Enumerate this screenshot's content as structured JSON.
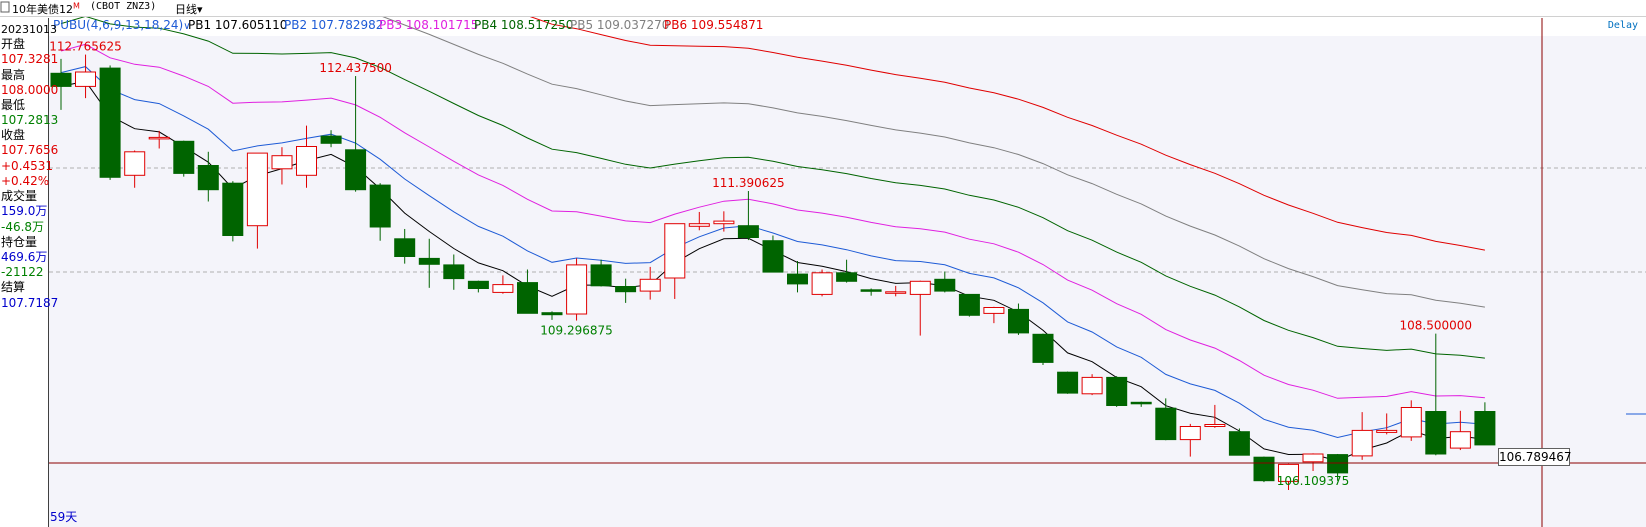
{
  "toolbar": {
    "title": "10年美债12",
    "title_sup": "M",
    "code": "(CBOT ZNZ3)",
    "period": "日线",
    "period_chevron": "▾"
  },
  "legend": {
    "indicator": "PUBU(4,6,9,13,18,24)",
    "items": [
      {
        "label": "PB1 107.605110",
        "color": "#000000"
      },
      {
        "label": "PB2 107.782982",
        "color": "#1e5bd6"
      },
      {
        "label": "PB3 108.101715",
        "color": "#e020e0"
      },
      {
        "label": "PB4 108.517250",
        "color": "#006400"
      },
      {
        "label": "PB5 109.037270",
        "color": "#808080"
      },
      {
        "label": "PB6 109.554871",
        "color": "#e00000"
      }
    ]
  },
  "info_panel": {
    "date": "20231013",
    "open_label": "开盘",
    "open_value": "107.3281",
    "high_label": "最高",
    "high_value": "108.0000",
    "low_label": "最低",
    "low_value": "107.2813",
    "close_label": "收盘",
    "close_value": "107.7656",
    "change": "+0.4531",
    "change_pct": "+0.42%",
    "volume_label": "成交量",
    "volume_value": "159.0万",
    "volume_change": "-46.8万",
    "oi_label": "持仓量",
    "oi_value": "469.6万",
    "oi_change": "-21122",
    "settle_label": "结算",
    "settle_value": "107.7187"
  },
  "status": {
    "delay": "Delay",
    "current_price": "106.789467",
    "day_count": "59天"
  },
  "colors": {
    "up": "#e00000",
    "down": "#006400",
    "background": "#f4f4fa",
    "crosshair": "#8b0000",
    "up_text": "#e00000",
    "down_text": "#008000",
    "neutral_text": "#0000cc"
  },
  "chart_data": {
    "type": "candlestick",
    "series_name": "10年美债12",
    "annotations": [
      {
        "label": "112.765625",
        "kind": "high",
        "index": 1
      },
      {
        "label": "112.437500",
        "kind": "high",
        "index": 12
      },
      {
        "label": "109.296875",
        "kind": "low",
        "index": 21
      },
      {
        "label": "111.390625",
        "kind": "high",
        "index": 28
      },
      {
        "label": "106.109375",
        "kind": "low",
        "index": 51
      },
      {
        "label": "108.500000",
        "kind": "high",
        "index": 56
      }
    ],
    "candles": [
      {
        "o": 112.48,
        "h": 112.7,
        "l": 111.92,
        "c": 112.28
      },
      {
        "o": 112.28,
        "h": 112.766,
        "l": 112.1,
        "c": 112.5
      },
      {
        "o": 112.56,
        "h": 112.6,
        "l": 110.85,
        "c": 110.89
      },
      {
        "o": 110.92,
        "h": 111.3,
        "l": 110.73,
        "c": 111.28
      },
      {
        "o": 111.5,
        "h": 111.6,
        "l": 111.33,
        "c": 111.5
      },
      {
        "o": 111.44,
        "h": 111.45,
        "l": 110.9,
        "c": 110.95
      },
      {
        "o": 111.07,
        "h": 111.28,
        "l": 110.52,
        "c": 110.7
      },
      {
        "o": 110.8,
        "h": 110.83,
        "l": 109.91,
        "c": 110.0
      },
      {
        "o": 110.15,
        "h": 111.26,
        "l": 109.8,
        "c": 111.26
      },
      {
        "o": 111.02,
        "h": 111.35,
        "l": 110.78,
        "c": 111.22
      },
      {
        "o": 110.92,
        "h": 111.68,
        "l": 110.73,
        "c": 111.36
      },
      {
        "o": 111.52,
        "h": 111.61,
        "l": 111.35,
        "c": 111.41
      },
      {
        "o": 111.31,
        "h": 112.4375,
        "l": 110.67,
        "c": 110.7
      },
      {
        "o": 110.77,
        "h": 110.8,
        "l": 109.92,
        "c": 110.13
      },
      {
        "o": 109.95,
        "h": 110.1,
        "l": 109.57,
        "c": 109.68
      },
      {
        "o": 109.65,
        "h": 109.95,
        "l": 109.2,
        "c": 109.56
      },
      {
        "o": 109.55,
        "h": 109.71,
        "l": 109.17,
        "c": 109.34
      },
      {
        "o": 109.3,
        "h": 109.31,
        "l": 109.13,
        "c": 109.19
      },
      {
        "o": 109.13,
        "h": 109.39,
        "l": 109.11,
        "c": 109.25
      },
      {
        "o": 109.28,
        "h": 109.48,
        "l": 108.81,
        "c": 108.81
      },
      {
        "o": 108.82,
        "h": 108.84,
        "l": 108.71,
        "c": 108.79
      },
      {
        "o": 108.8,
        "h": 109.65,
        "l": 108.7,
        "c": 109.55
      },
      {
        "o": 109.55,
        "h": 109.63,
        "l": 109.22,
        "c": 109.23
      },
      {
        "o": 109.22,
        "h": 109.34,
        "l": 108.97,
        "c": 109.14
      },
      {
        "o": 109.15,
        "h": 109.52,
        "l": 109.02,
        "c": 109.33
      },
      {
        "o": 109.35,
        "h": 110.18,
        "l": 109.03,
        "c": 110.18
      },
      {
        "o": 110.14,
        "h": 110.36,
        "l": 110.08,
        "c": 110.18
      },
      {
        "o": 110.18,
        "h": 110.37,
        "l": 110.06,
        "c": 110.22
      },
      {
        "o": 110.15,
        "h": 110.68,
        "l": 109.93,
        "c": 109.97
      },
      {
        "o": 109.92,
        "h": 110.0,
        "l": 109.44,
        "c": 109.44
      },
      {
        "o": 109.41,
        "h": 109.61,
        "l": 109.13,
        "c": 109.26
      },
      {
        "o": 109.1,
        "h": 109.48,
        "l": 109.07,
        "c": 109.43
      },
      {
        "o": 109.43,
        "h": 109.63,
        "l": 109.28,
        "c": 109.3
      },
      {
        "o": 109.17,
        "h": 109.19,
        "l": 109.08,
        "c": 109.15
      },
      {
        "o": 109.12,
        "h": 109.23,
        "l": 109.07,
        "c": 109.14
      },
      {
        "o": 109.1,
        "h": 109.31,
        "l": 108.47,
        "c": 109.3
      },
      {
        "o": 109.33,
        "h": 109.45,
        "l": 109.13,
        "c": 109.15
      },
      {
        "o": 109.1,
        "h": 109.1,
        "l": 108.76,
        "c": 108.78
      },
      {
        "o": 108.81,
        "h": 108.91,
        "l": 108.66,
        "c": 108.9
      },
      {
        "o": 108.87,
        "h": 108.96,
        "l": 108.48,
        "c": 108.51
      },
      {
        "o": 108.49,
        "h": 108.5,
        "l": 108.02,
        "c": 108.06
      },
      {
        "o": 107.91,
        "h": 107.92,
        "l": 107.58,
        "c": 107.59
      },
      {
        "o": 107.58,
        "h": 107.88,
        "l": 107.56,
        "c": 107.83
      },
      {
        "o": 107.83,
        "h": 107.85,
        "l": 107.38,
        "c": 107.4
      },
      {
        "o": 107.45,
        "h": 107.46,
        "l": 107.38,
        "c": 107.44
      },
      {
        "o": 107.36,
        "h": 107.51,
        "l": 106.87,
        "c": 106.88
      },
      {
        "o": 106.88,
        "h": 107.12,
        "l": 106.62,
        "c": 107.08
      },
      {
        "o": 107.08,
        "h": 107.41,
        "l": 107.06,
        "c": 107.11
      },
      {
        "o": 107.0,
        "h": 107.05,
        "l": 106.64,
        "c": 106.64
      },
      {
        "o": 106.61,
        "h": 106.62,
        "l": 106.23,
        "c": 106.25
      },
      {
        "o": 106.24,
        "h": 106.51,
        "l": 106.109,
        "c": 106.5
      },
      {
        "o": 106.54,
        "h": 106.67,
        "l": 106.4,
        "c": 106.66
      },
      {
        "o": 106.65,
        "h": 106.66,
        "l": 106.25,
        "c": 106.37
      },
      {
        "o": 106.63,
        "h": 107.3,
        "l": 106.57,
        "c": 107.02
      },
      {
        "o": 106.99,
        "h": 107.28,
        "l": 106.96,
        "c": 107.02
      },
      {
        "o": 106.92,
        "h": 107.48,
        "l": 106.86,
        "c": 107.37
      },
      {
        "o": 107.31,
        "h": 108.5,
        "l": 106.64,
        "c": 106.66
      },
      {
        "o": 106.75,
        "h": 107.32,
        "l": 106.72,
        "c": 107.0
      },
      {
        "o": 107.31,
        "h": 107.45,
        "l": 106.8,
        "c": 106.8
      }
    ]
  }
}
